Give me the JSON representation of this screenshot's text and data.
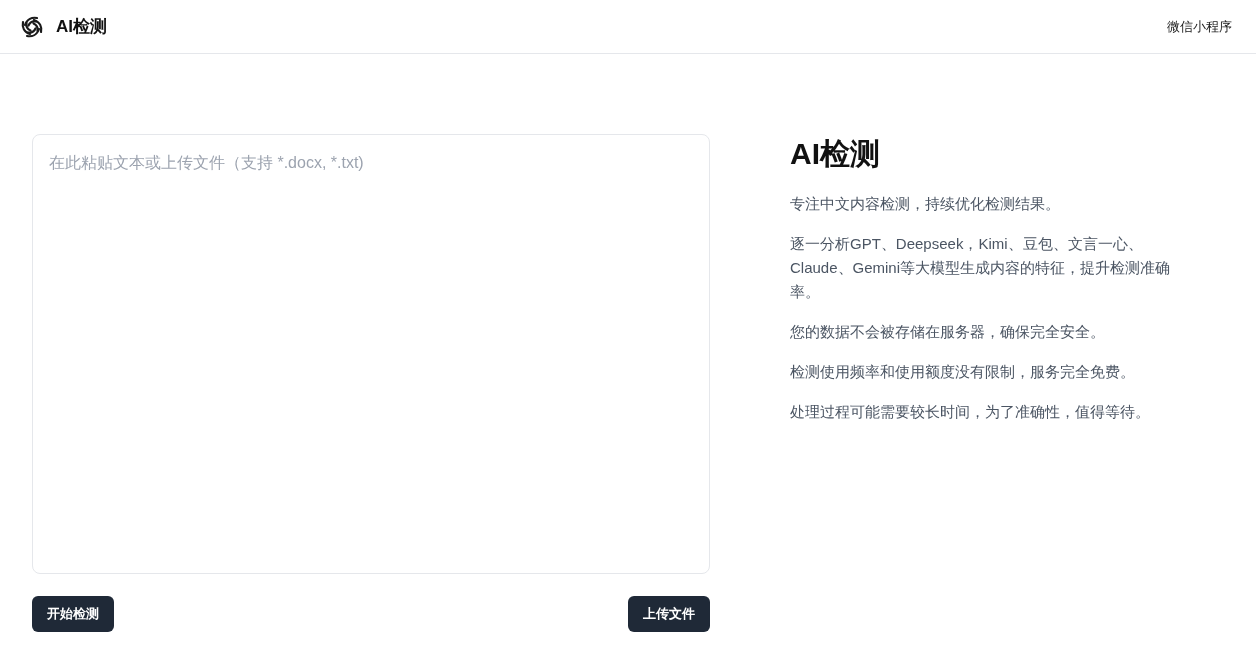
{
  "header": {
    "brand": "AI检测",
    "links": [
      {
        "label": "微信小程序"
      }
    ]
  },
  "editor": {
    "placeholder": "在此粘贴文本或上传文件（支持 *.docx, *.txt)",
    "buttons": [
      {
        "label": "开始检测"
      },
      {
        "label": "上传文件"
      }
    ]
  },
  "info": {
    "title": "AI检测",
    "paragraphs": [
      "专注中文内容检测，持续优化检测结果。",
      "逐一分析GPT、Deepseek，Kimi、豆包、文言一心、Claude、Gemini等大模型生成内容的特征，提升检测准确率。",
      "您的数据不会被存储在服务器，确保完全安全。",
      "检测使用频率和使用额度没有限制，服务完全免费。",
      "处理过程可能需要较长时间，为了准确性，值得等待。"
    ]
  }
}
